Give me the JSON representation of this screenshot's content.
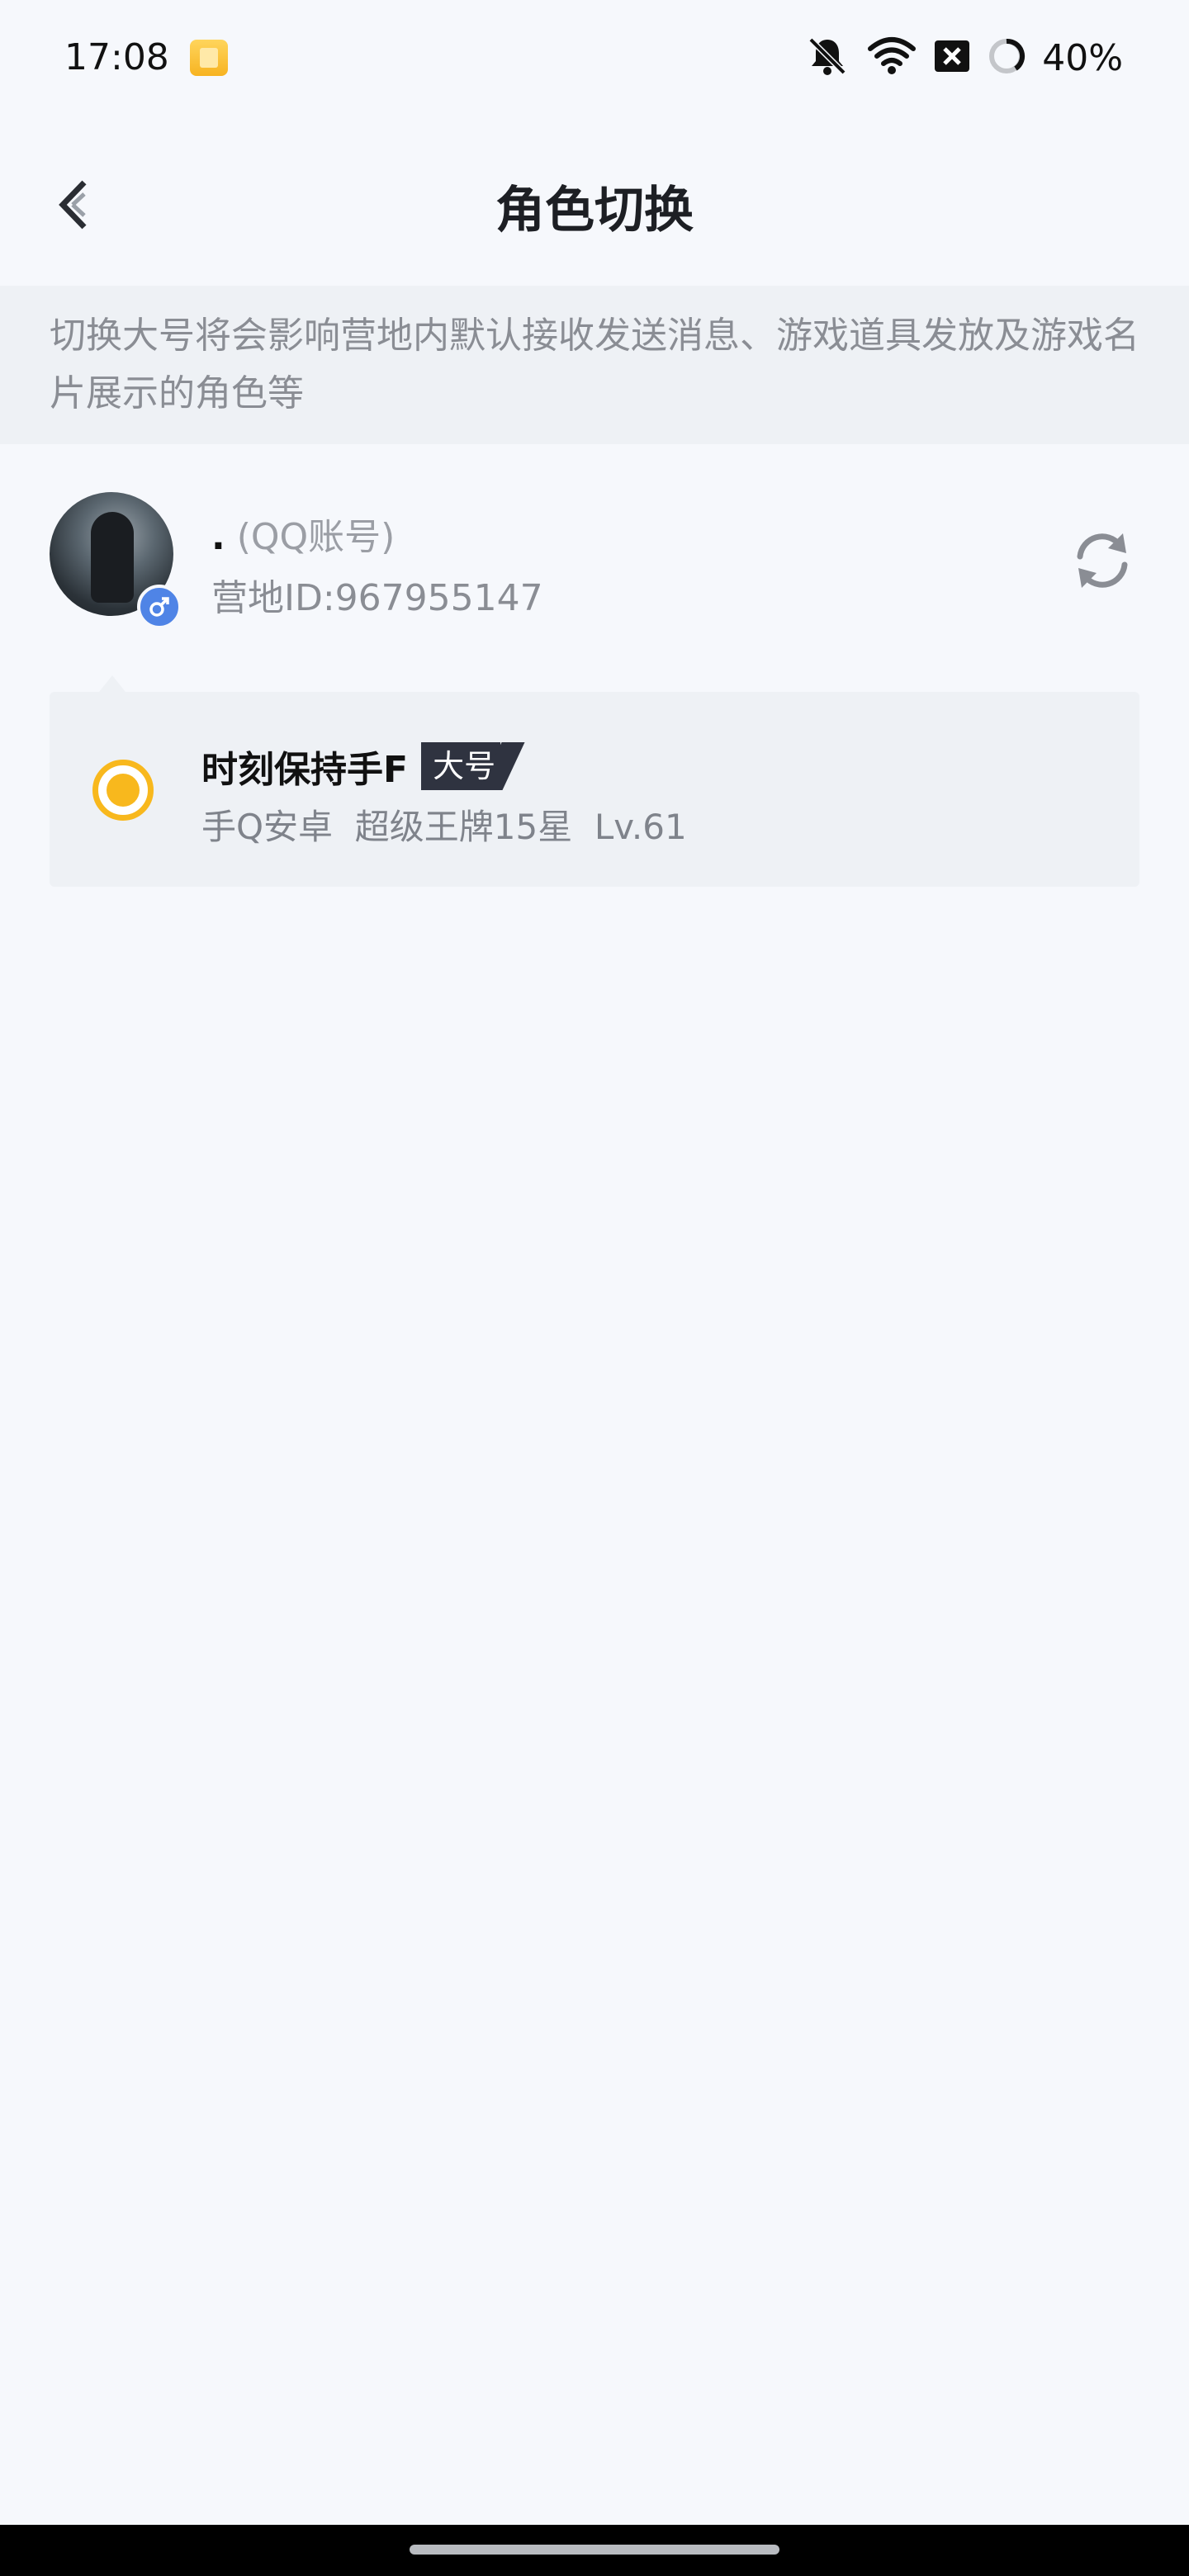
{
  "status_bar": {
    "time": "17:08",
    "battery_percent": "40%",
    "icons": [
      "app-notification-icon",
      "mute-bell-icon",
      "wifi-icon",
      "sim-blocked-icon",
      "battery-charging-icon"
    ]
  },
  "nav": {
    "title": "角色切换",
    "back_icon": "back-arrow-icon"
  },
  "notice": {
    "text": "切换大号将会影响营地内默认接收发送消息、游戏道具发放及游戏名片展示的角色等"
  },
  "account": {
    "name": ".",
    "account_type": "(QQ账号)",
    "camp_id": "营地ID:967955147",
    "gender_icon": "male-icon",
    "refresh_icon": "refresh-icon"
  },
  "role": {
    "name": "时刻保持手F",
    "badge": "大号",
    "info": "手Q安卓  超级王牌15星  Lv.61",
    "selected": true,
    "accent_color": "#f8b81d"
  }
}
